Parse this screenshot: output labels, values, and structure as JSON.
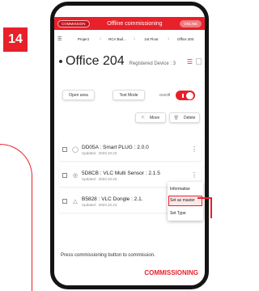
{
  "step": {
    "number": "14"
  },
  "colors": {
    "accent": "#e8202a"
  },
  "top_bar": {
    "left_pill": "COMMISSION",
    "title": "Offline commissioning",
    "right_pill": "ONLINE"
  },
  "breadcrumb": {
    "menu_icon": "menu-icon",
    "items": [
      "Project",
      "RCA Buil...",
      "1st Floor",
      "Office 204"
    ]
  },
  "room": {
    "title": "Office 204",
    "registered": "Registered Device : 3"
  },
  "controls": {
    "open_area": "Open area",
    "test_mode": "Test Mode",
    "on_off": "On/Off",
    "move": "Move",
    "delete": "Delete",
    "toggle_on": true
  },
  "devices": [
    {
      "title": "DD05A : Smart PLUG : 2.0.0",
      "updated": "Updated : 2023.10.23",
      "icon": "router-icon"
    },
    {
      "title": "5D8CB : VLC Multi Sensor : 2.1.5",
      "updated": "Updated : 2023.10.23",
      "icon": "sensor-icon"
    },
    {
      "title": "B5828 : VLC Dongle : 2.1.",
      "updated": "Updated : 2023.10.23",
      "icon": "dongle-icon"
    }
  ],
  "context_menu": {
    "items": [
      "Informatise",
      "Set as master",
      "Set Type"
    ],
    "highlighted": "Set as master"
  },
  "footer": {
    "message": "Press commissioning button to commission.",
    "button": "COMMISSIONING"
  }
}
